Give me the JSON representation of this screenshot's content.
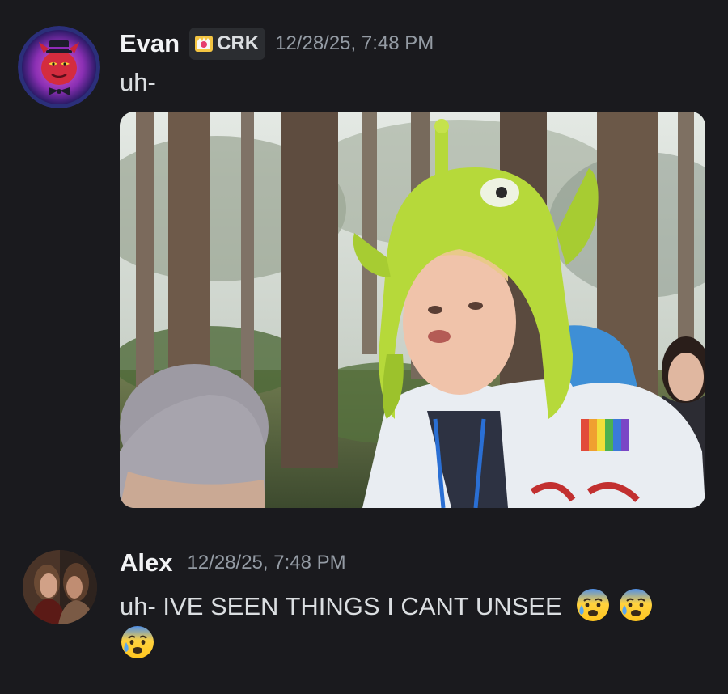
{
  "messages": [
    {
      "author": "Evan",
      "tag": "CRK",
      "timestamp": "12/28/25, 7:48 PM",
      "text": "uh-"
    },
    {
      "author": "Alex",
      "timestamp": "12/28/25, 7:48 PM",
      "text": "uh- IVE SEEN THINGS I CANT UNSEE"
    }
  ],
  "emojis": [
    "anxious-face-with-sweat",
    "anxious-face-with-sweat",
    "anxious-face-with-sweat"
  ],
  "colors": {
    "background": "#1a1a1e",
    "username": "#f2f3f5",
    "text": "#dbdee1",
    "timestamp": "#949ba4",
    "tag_bg": "#2b2d31"
  }
}
